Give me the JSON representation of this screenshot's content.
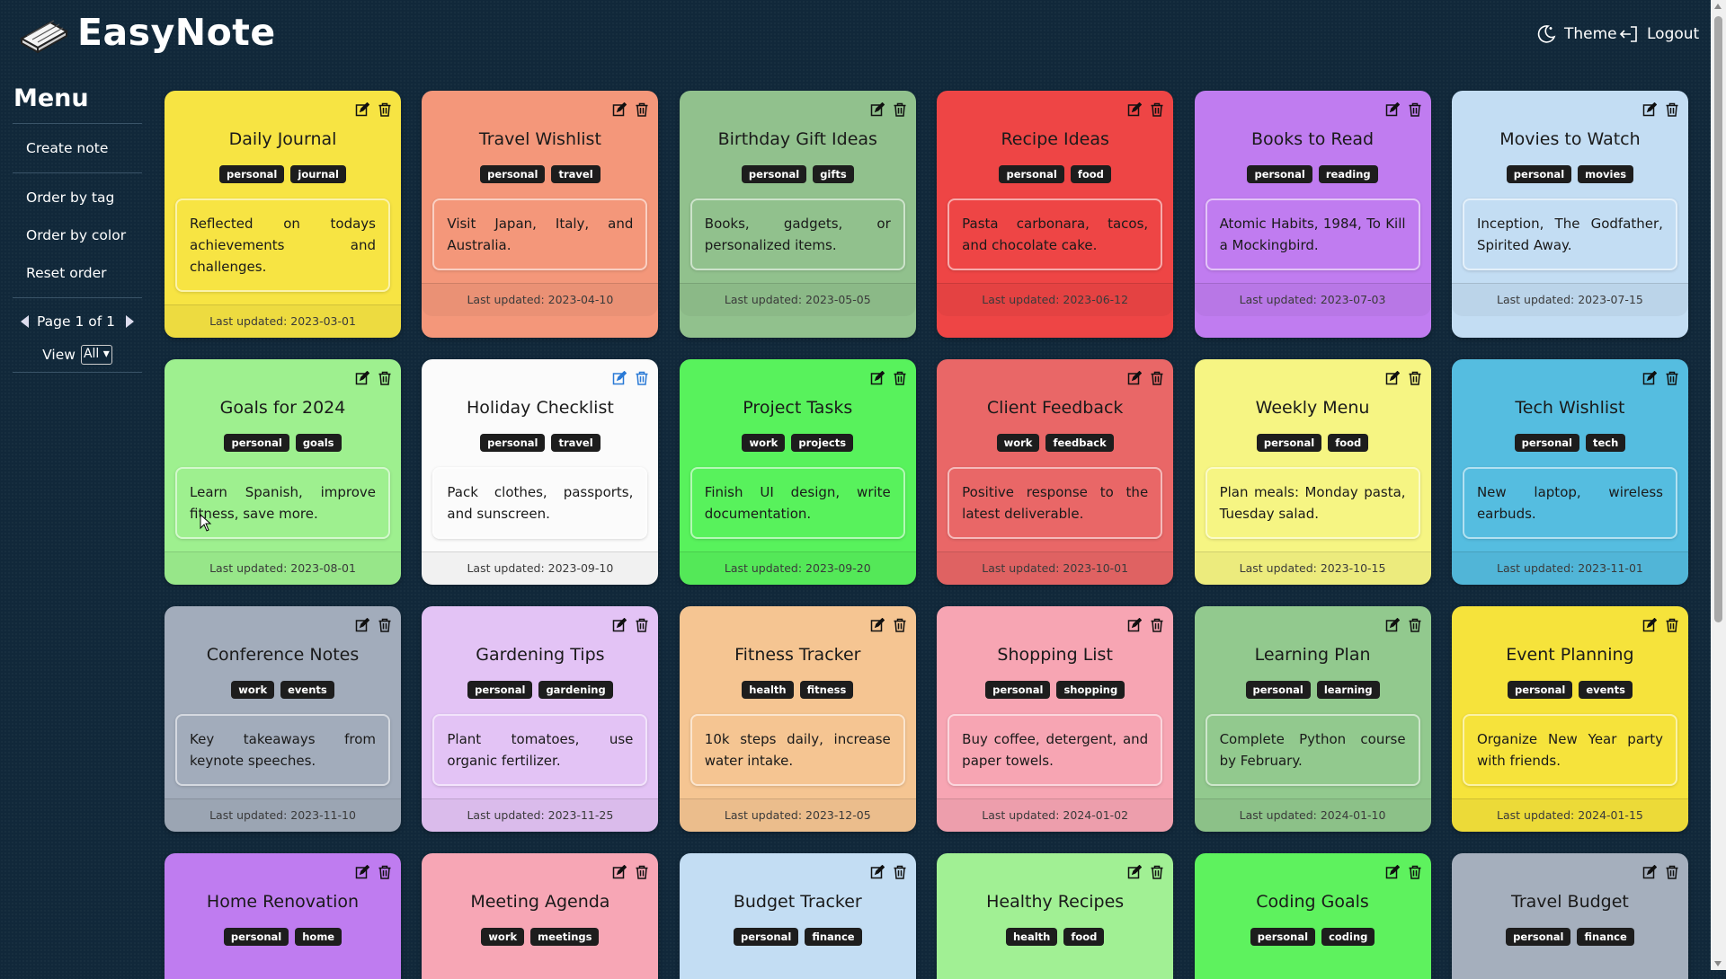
{
  "app": {
    "title": "EasyNote"
  },
  "header": {
    "theme_label": "Theme",
    "logout_label": "Logout"
  },
  "sidebar": {
    "title": "Menu",
    "items": [
      {
        "label": "Create note"
      },
      {
        "label": "Order by tag"
      },
      {
        "label": "Order by color"
      },
      {
        "label": "Reset order"
      }
    ],
    "page_label": "Page 1 of 1",
    "view_label": "View",
    "view_value": "All"
  },
  "notes": [
    {
      "title": "Daily Journal",
      "tags": [
        "personal",
        "journal"
      ],
      "content": "Reflected on todays achievements and challenges.",
      "updated": "Last updated: 2023-03-01",
      "color": "#f7e443"
    },
    {
      "title": "Travel Wishlist",
      "tags": [
        "personal",
        "travel"
      ],
      "content": "Visit Japan, Italy, and Australia.",
      "updated": "Last updated: 2023-04-10",
      "color": "#f4977a"
    },
    {
      "title": "Birthday Gift Ideas",
      "tags": [
        "personal",
        "gifts"
      ],
      "content": "Books, gadgets, or personalized items.",
      "updated": "Last updated: 2023-05-05",
      "color": "#91c18d"
    },
    {
      "title": "Recipe Ideas",
      "tags": [
        "personal",
        "food"
      ],
      "content": "Pasta carbonara, tacos, and chocolate cake.",
      "updated": "Last updated: 2023-06-12",
      "color": "#ee4545"
    },
    {
      "title": "Books to Read",
      "tags": [
        "personal",
        "reading"
      ],
      "content": "Atomic Habits, 1984, To Kill a Mockingbird.",
      "updated": "Last updated: 2023-07-03",
      "color": "#c07cf0"
    },
    {
      "title": "Movies to Watch",
      "tags": [
        "personal",
        "movies"
      ],
      "content": "Inception, The Godfather, Spirited Away.",
      "updated": "Last updated: 2023-07-15",
      "color": "#c3ddf3"
    },
    {
      "title": "Goals for 2024",
      "tags": [
        "personal",
        "goals"
      ],
      "content": "Learn Spanish, improve fitness, save more.",
      "updated": "Last updated: 2023-08-01",
      "color": "#9ef08f"
    },
    {
      "title": "Holiday Checklist",
      "tags": [
        "personal",
        "travel"
      ],
      "content": "Pack clothes, passports, and sunscreen.",
      "updated": "Last updated: 2023-09-10",
      "color": "#fbfbfb"
    },
    {
      "title": "Project Tasks",
      "tags": [
        "work",
        "projects"
      ],
      "content": "Finish UI design, write documentation.",
      "updated": "Last updated: 2023-09-20",
      "color": "#58f25c"
    },
    {
      "title": "Client Feedback",
      "tags": [
        "work",
        "feedback"
      ],
      "content": "Positive response to the latest deliverable.",
      "updated": "Last updated: 2023-10-01",
      "color": "#e96767"
    },
    {
      "title": "Weekly Menu",
      "tags": [
        "personal",
        "food"
      ],
      "content": "Plan meals: Monday pasta, Tuesday salad.",
      "updated": "Last updated: 2023-10-15",
      "color": "#f6f583"
    },
    {
      "title": "Tech Wishlist",
      "tags": [
        "personal",
        "tech"
      ],
      "content": "New laptop, wireless earbuds.",
      "updated": "Last updated: 2023-11-01",
      "color": "#55bde0"
    },
    {
      "title": "Conference Notes",
      "tags": [
        "work",
        "events"
      ],
      "content": "Key takeaways from keynote speeches.",
      "updated": "Last updated: 2023-11-10",
      "color": "#a2acbb"
    },
    {
      "title": "Gardening Tips",
      "tags": [
        "personal",
        "gardening"
      ],
      "content": "Plant tomatoes, use organic fertilizer.",
      "updated": "Last updated: 2023-11-25",
      "color": "#e3c3f5"
    },
    {
      "title": "Fitness Tracker",
      "tags": [
        "health",
        "fitness"
      ],
      "content": "10k steps daily, increase water intake.",
      "updated": "Last updated: 2023-12-05",
      "color": "#f5c592"
    },
    {
      "title": "Shopping List",
      "tags": [
        "personal",
        "shopping"
      ],
      "content": "Buy coffee, detergent, and paper towels.",
      "updated": "Last updated: 2024-01-02",
      "color": "#f7a5b3"
    },
    {
      "title": "Learning Plan",
      "tags": [
        "personal",
        "learning"
      ],
      "content": "Complete Python course by February.",
      "updated": "Last updated: 2024-01-10",
      "color": "#92c98e"
    },
    {
      "title": "Event Planning",
      "tags": [
        "personal",
        "events"
      ],
      "content": "Organize New Year party with friends.",
      "updated": "Last updated: 2024-01-15",
      "color": "#f6e33b"
    },
    {
      "title": "Home Renovation",
      "tags": [
        "personal",
        "home"
      ],
      "content": "",
      "updated": "",
      "color": "#bf7cf0"
    },
    {
      "title": "Meeting Agenda",
      "tags": [
        "work",
        "meetings"
      ],
      "content": "",
      "updated": "",
      "color": "#f7a6b5"
    },
    {
      "title": "Budget Tracker",
      "tags": [
        "personal",
        "finance"
      ],
      "content": "",
      "updated": "",
      "color": "#c3ddf3"
    },
    {
      "title": "Healthy Recipes",
      "tags": [
        "health",
        "food"
      ],
      "content": "",
      "updated": "",
      "color": "#a1f094"
    },
    {
      "title": "Coding Goals",
      "tags": [
        "personal",
        "coding"
      ],
      "content": "",
      "updated": "",
      "color": "#5ef25e"
    },
    {
      "title": "Travel Budget",
      "tags": [
        "personal",
        "finance"
      ],
      "content": "",
      "updated": "",
      "color": "#a5afbd"
    }
  ]
}
